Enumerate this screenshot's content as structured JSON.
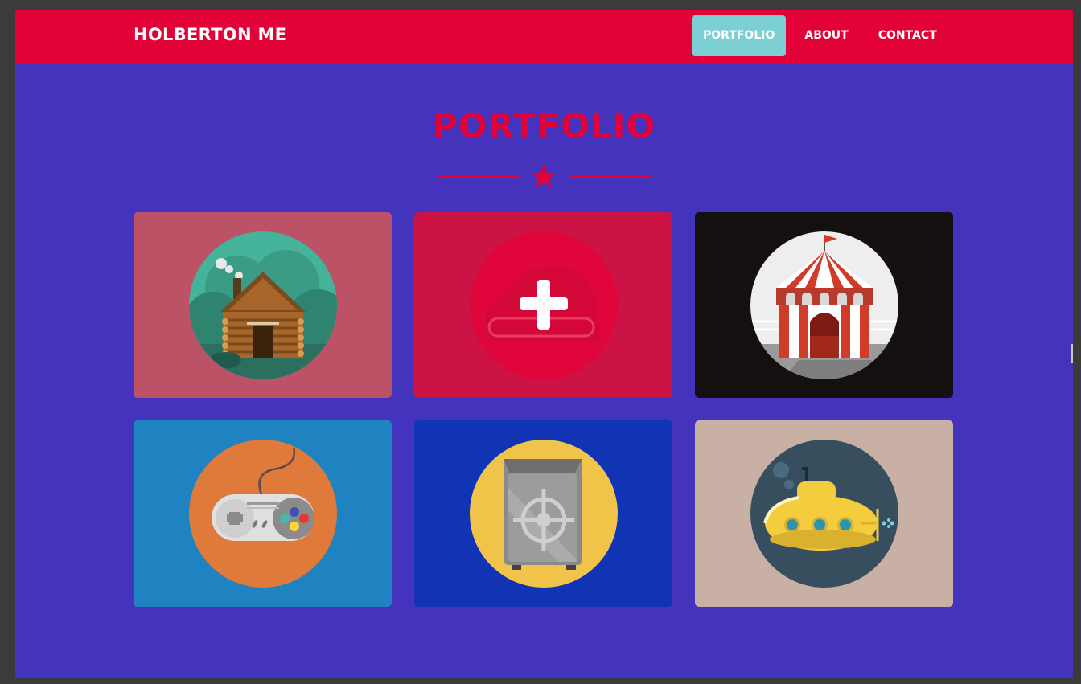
{
  "navbar": {
    "brand": "HOLBERTON ME",
    "items": [
      {
        "label": "PORTFOLIO",
        "active": true
      },
      {
        "label": "ABOUT",
        "active": false
      },
      {
        "label": "CONTACT",
        "active": false
      }
    ]
  },
  "section": {
    "title": "PORTFOLIO",
    "divider_icon": "star-icon"
  },
  "portfolio": {
    "items": [
      {
        "icon": "log-cabin-icon",
        "background": "#bc5265"
      },
      {
        "icon": "plus-overlay-icon",
        "background": "#cc1346",
        "hovered": true
      },
      {
        "icon": "circus-tent-icon",
        "background": "#141010"
      },
      {
        "icon": "game-controller-icon",
        "background": "#1f82c1"
      },
      {
        "icon": "safe-icon",
        "background": "#1034b4"
      },
      {
        "icon": "submarine-icon",
        "background": "#c9b0a5"
      }
    ]
  },
  "colors": {
    "primary": "#e20237",
    "background": "#4333bd",
    "active_nav": "#7ccfd3"
  }
}
